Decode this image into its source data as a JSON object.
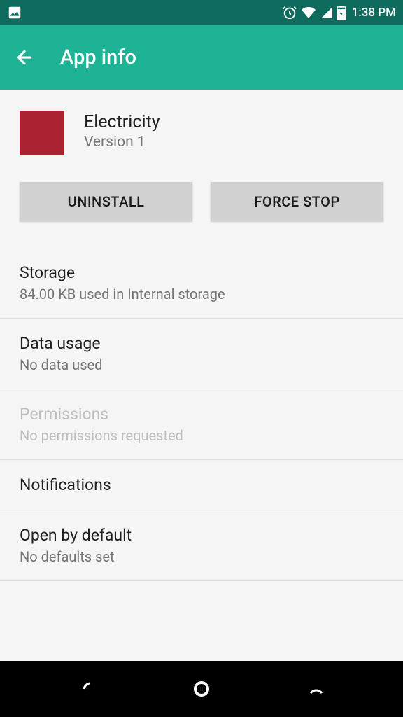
{
  "status": {
    "time": "1:38 PM"
  },
  "appbar": {
    "title": "App info"
  },
  "app": {
    "name": "Electricity",
    "version": "Version 1",
    "icon_color": "#ab2232"
  },
  "buttons": {
    "uninstall": "UNINSTALL",
    "force_stop": "FORCE STOP"
  },
  "sections": {
    "storage": {
      "title": "Storage",
      "sub": "84.00 KB used in Internal storage"
    },
    "data_usage": {
      "title": "Data usage",
      "sub": "No data used"
    },
    "permissions": {
      "title": "Permissions",
      "sub": "No permissions requested"
    },
    "notifications": {
      "title": "Notifications"
    },
    "open_default": {
      "title": "Open by default",
      "sub": "No defaults set"
    }
  }
}
